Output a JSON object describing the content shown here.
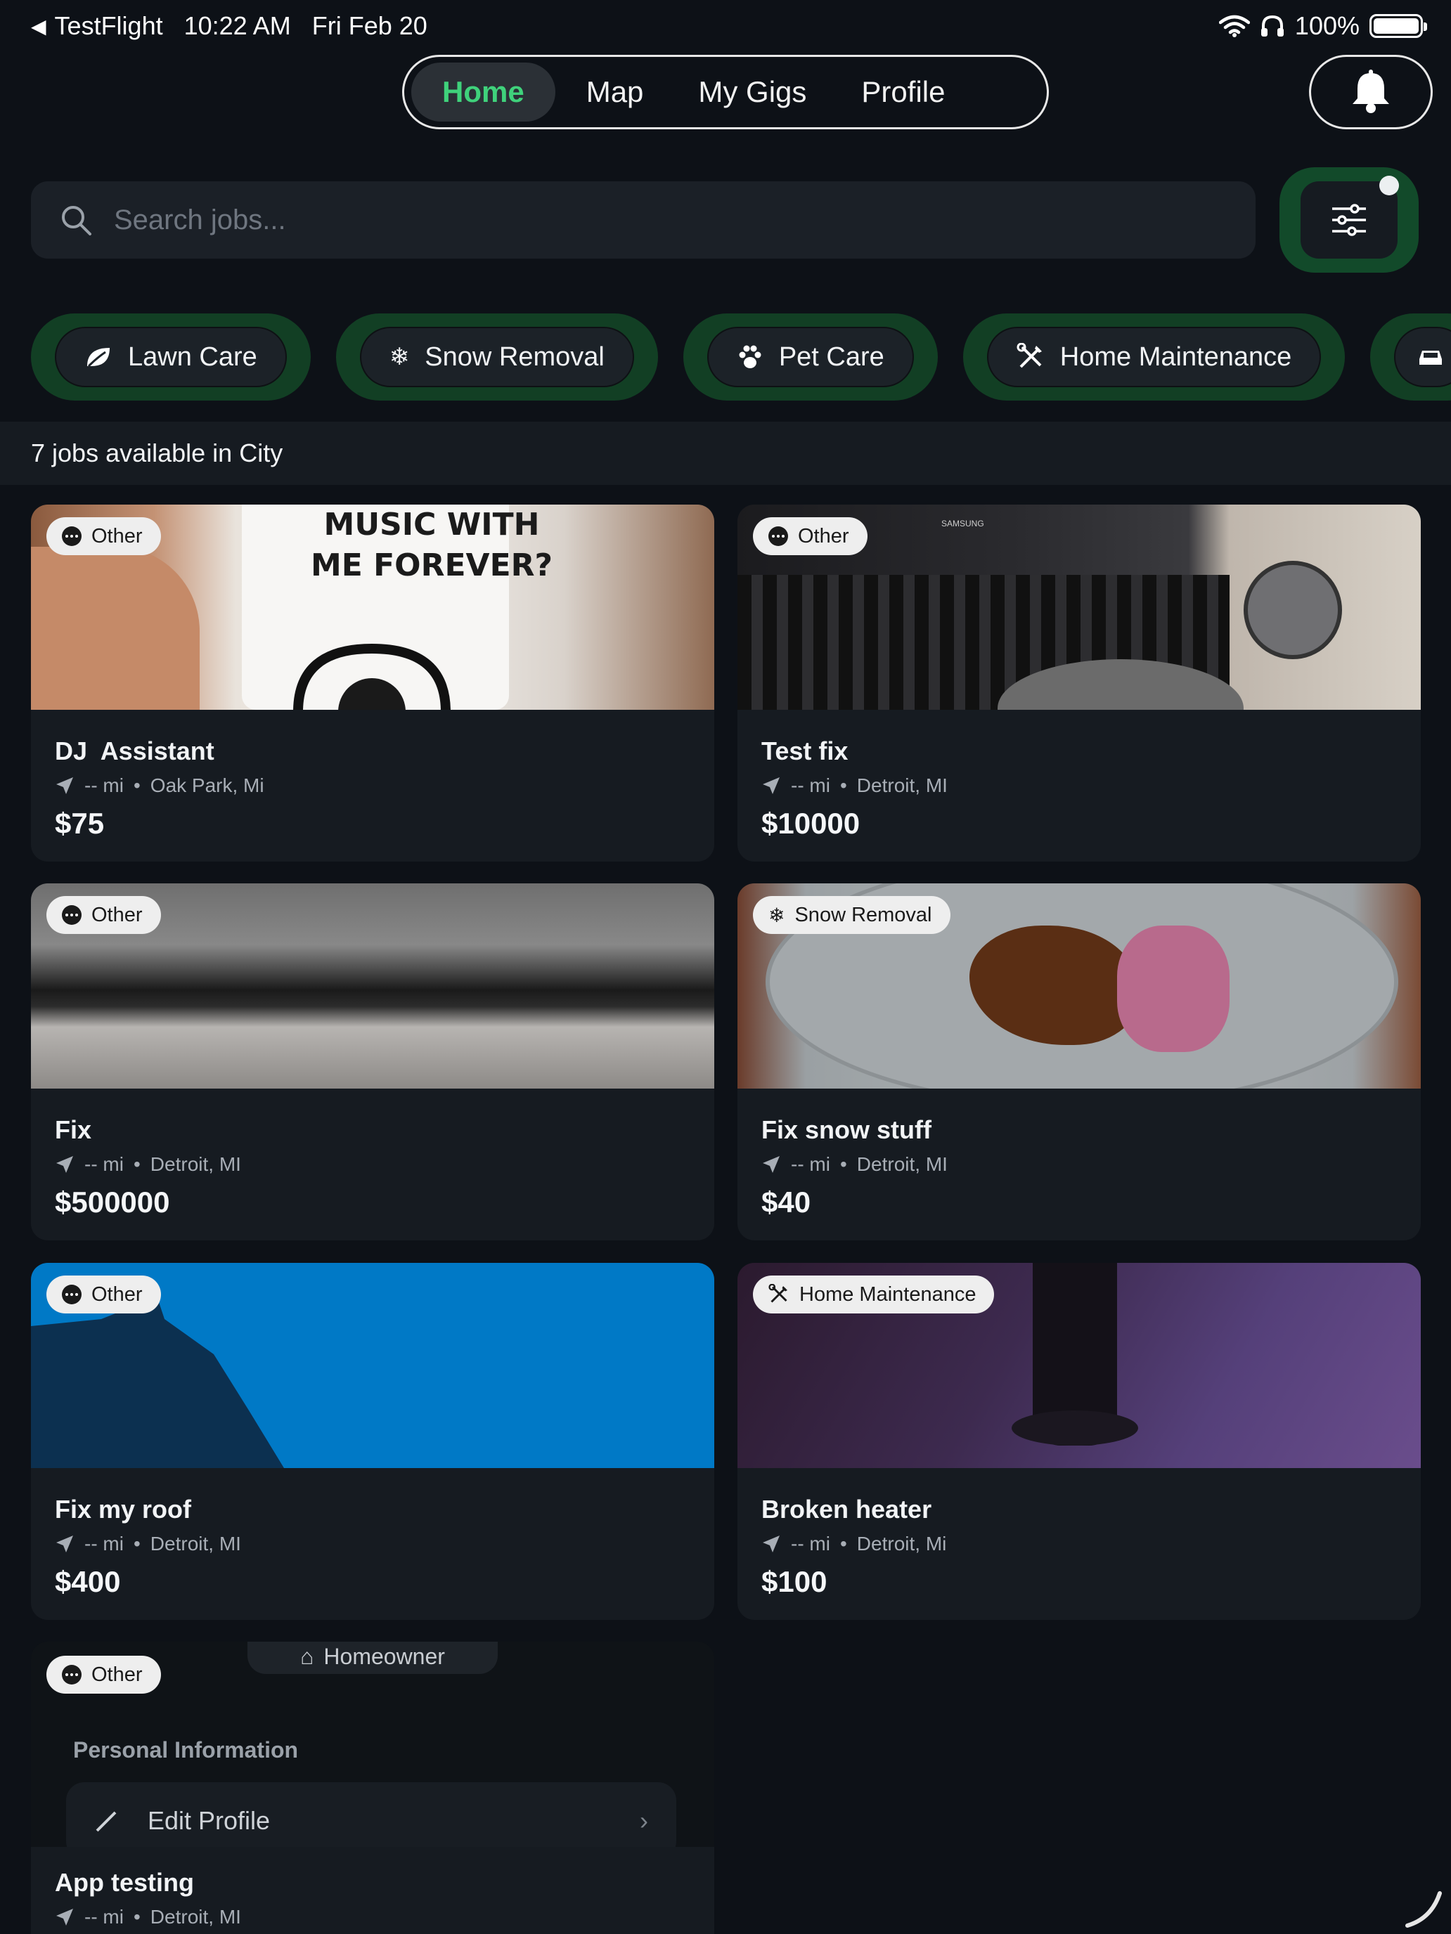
{
  "status_bar": {
    "back_app": "TestFlight",
    "time": "10:22 AM",
    "date": "Fri Feb 20",
    "battery": "100%"
  },
  "nav": {
    "tabs": [
      {
        "label": "Home",
        "active": true
      },
      {
        "label": "Map",
        "active": false
      },
      {
        "label": "My Gigs",
        "active": false
      },
      {
        "label": "Profile",
        "active": false
      }
    ],
    "bell_icon": "bell-icon"
  },
  "search": {
    "placeholder": "Search jobs...",
    "value": ""
  },
  "categories": [
    {
      "label": "Lawn Care",
      "icon": "leaf-icon"
    },
    {
      "label": "Snow Removal",
      "icon": "snowflake-icon"
    },
    {
      "label": "Pet Care",
      "icon": "paw-icon"
    },
    {
      "label": "Home Maintenance",
      "icon": "tools-icon"
    }
  ],
  "jobs_count_text": "7 jobs available in City",
  "jobs": [
    {
      "category": "Other",
      "title": "DJ  Assistant",
      "distance": "-- mi",
      "location": "Oak Park, Mi",
      "price": "$75",
      "image_text": "MUSIC WITH\nME FOREVER?"
    },
    {
      "category": "Other",
      "title": "Test fix",
      "distance": "-- mi",
      "location": "Detroit, MI",
      "price": "$10000",
      "image_text": "SAMSUNG"
    },
    {
      "category": "Other",
      "title": "Fix",
      "distance": "-- mi",
      "location": "Detroit, MI",
      "price": "$500000"
    },
    {
      "category": "Snow Removal",
      "title": "Fix snow stuff",
      "distance": "-- mi",
      "location": "Detroit, MI",
      "price": "$40"
    },
    {
      "category": "Other",
      "title": "Fix my roof",
      "distance": "-- mi",
      "location": "Detroit, MI",
      "price": "$400"
    },
    {
      "category": "Home Maintenance",
      "title": "Broken heater",
      "distance": "-- mi",
      "location": "Detroit, Mi",
      "price": "$100"
    },
    {
      "category": "Other",
      "title": "App testing",
      "distance": "-- mi",
      "location": "Detroit, MI"
    }
  ],
  "last_card_overlay": {
    "role_chip": "Homeowner",
    "section_title": "Personal Information",
    "edit_profile": "Edit Profile"
  },
  "colors": {
    "background": "#0d1117",
    "card": "#161b21",
    "accent": "#3fd27b",
    "chip_glow": "#123f24"
  }
}
